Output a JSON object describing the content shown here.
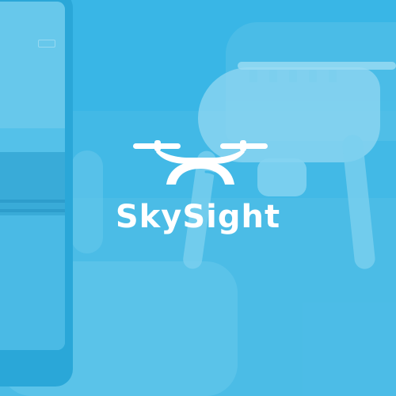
{
  "brand": {
    "name": "SkySight",
    "icon": "drone-icon",
    "logo_color": "#ffffff",
    "overlay_color": "#2cb2e6"
  },
  "background": {
    "icons": [
      "smartphone",
      "drone",
      "hand",
      "city-plaza"
    ]
  }
}
